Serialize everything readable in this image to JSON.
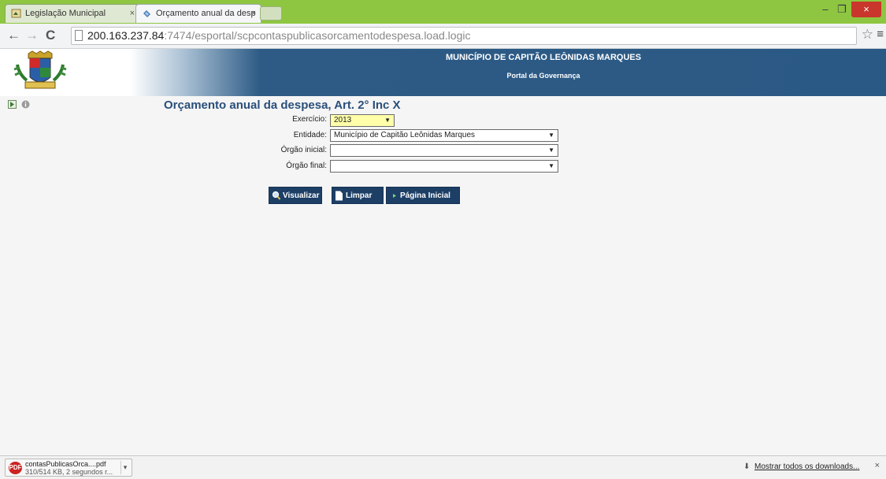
{
  "browser": {
    "tabs": [
      {
        "title": "Legislação Municipal",
        "close": "×"
      },
      {
        "title": "Orçamento anual da desp",
        "close": "×"
      }
    ],
    "window_controls": {
      "minimize": "–",
      "restore": "❐",
      "close": "×"
    },
    "url_host": "200.163.237.84",
    "url_rest": ":7474/esportal/scpcontaspublicasorcamentodespesa.load.logic",
    "nav": {
      "back": "←",
      "forward": "→",
      "reload": "C"
    },
    "star": "☆",
    "menu": "≡"
  },
  "header": {
    "title": "MUNICÍPIO DE CAPITÃO LEÔNIDAS MARQUES",
    "subtitle": "Portal da Governança"
  },
  "form": {
    "title": "Orçamento anual da despesa, Art. 2° Inc X",
    "fields": [
      {
        "label": "Exercício:",
        "value": "2013"
      },
      {
        "label": "Entidade:",
        "value": "Município de Capitão Leônidas Marques"
      },
      {
        "label": "Órgão inicial:",
        "value": ""
      },
      {
        "label": "Órgão final:",
        "value": ""
      }
    ],
    "buttons": {
      "visualizar": "Visualizar",
      "limpar": "Limpar",
      "pagina_inicial": "Página Inicial"
    }
  },
  "downloads": {
    "file_name": "contasPublicasOrca....pdf",
    "status": "310/514 KB, 2 segundos r...",
    "show_all": "Mostrar todos os downloads...",
    "close": "×"
  },
  "colors": {
    "tabstrip": "#8ec641",
    "header_blue": "#2b5985",
    "button_blue": "#1d3f66",
    "title_blue": "#2a4f7a",
    "exercicio_highlight": "#ffffaa"
  }
}
